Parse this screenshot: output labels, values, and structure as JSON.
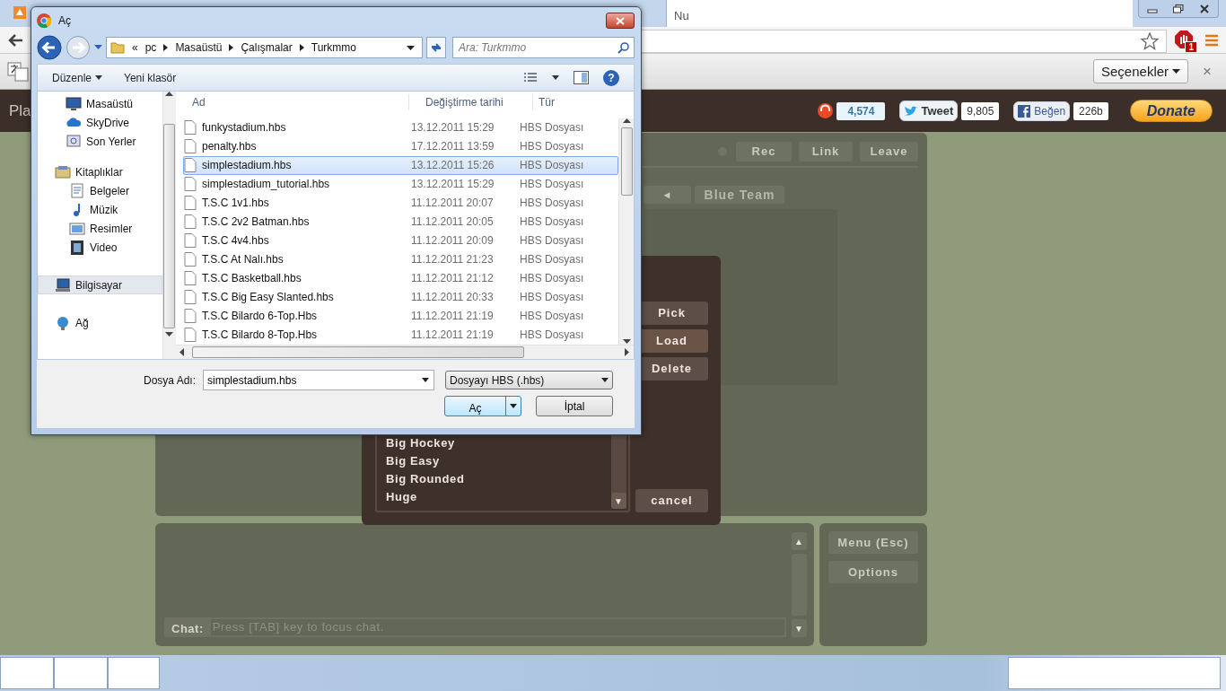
{
  "browser": {
    "tab_title": "Nu",
    "adblock_count": "1",
    "translate_options": "Seçenekler",
    "translate_close": "×"
  },
  "site_header": {
    "title": "Pla",
    "stumble_count": "4,574",
    "tweet": "Tweet",
    "tweet_count": "9,805",
    "like": "Beğen",
    "like_count": "226b",
    "donate": "Donate"
  },
  "room": {
    "top_buttons": [
      "Rec",
      "Link",
      "Leave"
    ],
    "team_arrow": "◄",
    "team_name": "Blue Team"
  },
  "chat": {
    "label": "Chat:",
    "placeholder": "Press [TAB] key to focus chat.",
    "scroll_up": "▲",
    "scroll_down": "▼"
  },
  "side_buttons": [
    "Menu (Esc)",
    "Options"
  ],
  "stadium_picker": {
    "stadiums": [
      {
        "name": "Big Hockey"
      },
      {
        "name": "Big Easy"
      },
      {
        "name": "Big Rounded"
      },
      {
        "name": "Huge"
      }
    ],
    "buttons": [
      "Pick",
      "Load",
      "Delete"
    ],
    "cancel": "cancel",
    "scroll_down": "▼"
  },
  "file_dialog": {
    "title": "Aç",
    "overflow": "«",
    "breadcrumb": [
      "pc",
      "Masaüstü",
      "Çalışmalar",
      "Turkmmo"
    ],
    "search_placeholder": "Ara: Turkmmo",
    "toolbar": {
      "organize": "Düzenle",
      "new_folder": "Yeni klasör",
      "help": "?"
    },
    "nav": [
      {
        "label": "Masaüstü",
        "kind": "desktop",
        "selected": false
      },
      {
        "label": "SkyDrive",
        "kind": "cloud",
        "selected": false
      },
      {
        "label": "Son Yerler",
        "kind": "recent",
        "selected": false
      },
      {
        "label": "Kitaplıklar",
        "kind": "library",
        "selected": false,
        "children": [
          {
            "label": "Belgeler",
            "kind": "documents",
            "selected": false
          },
          {
            "label": "Müzik",
            "kind": "music",
            "selected": false
          },
          {
            "label": "Resimler",
            "kind": "pictures",
            "selected": false
          },
          {
            "label": "Video",
            "kind": "video",
            "selected": false
          }
        ]
      },
      {
        "label": "Bilgisayar",
        "kind": "computer",
        "selected": true
      },
      {
        "label": "Ağ",
        "kind": "network",
        "selected": false
      }
    ],
    "columns": [
      "Ad",
      "Değiştirme tarihi",
      "Tür"
    ],
    "files": [
      {
        "name": "funkystadium.hbs",
        "modified": "13.12.2011 15:29",
        "type": "HBS Dosyası",
        "selected": false
      },
      {
        "name": "penalty.hbs",
        "modified": "17.12.2011 13:59",
        "type": "HBS Dosyası",
        "selected": false
      },
      {
        "name": "simplestadium.hbs",
        "modified": "13.12.2011 15:26",
        "type": "HBS Dosyası",
        "selected": true
      },
      {
        "name": "simplestadium_tutorial.hbs",
        "modified": "13.12.2011 15:29",
        "type": "HBS Dosyası",
        "selected": false
      },
      {
        "name": "T.S.C 1v1.hbs",
        "modified": "11.12.2011 20:07",
        "type": "HBS Dosyası",
        "selected": false
      },
      {
        "name": "T.S.C 2v2 Batman.hbs",
        "modified": "11.12.2011 20:05",
        "type": "HBS Dosyası",
        "selected": false
      },
      {
        "name": "T.S.C 4v4.hbs",
        "modified": "11.12.2011 20:09",
        "type": "HBS Dosyası",
        "selected": false
      },
      {
        "name": "T.S.C At Nalı.hbs",
        "modified": "11.12.2011 21:23",
        "type": "HBS Dosyası",
        "selected": false
      },
      {
        "name": "T.S.C Basketball.hbs",
        "modified": "11.12.2011 21:12",
        "type": "HBS Dosyası",
        "selected": false
      },
      {
        "name": "T.S.C Big Easy Slanted.hbs",
        "modified": "11.12.2011 20:33",
        "type": "HBS Dosyası",
        "selected": false
      },
      {
        "name": "T.S.C Bilardo 6-Top.Hbs",
        "modified": "11.12.2011 21:19",
        "type": "HBS Dosyası",
        "selected": false
      },
      {
        "name": "T.S.C Bilardo 8-Top.Hbs",
        "modified": "11.12.2011 21:19",
        "type": "HBS Dosyası",
        "selected": false
      }
    ],
    "file_name_label": "Dosya Adı:",
    "file_name": "simplestadium.hbs",
    "filter": "Dosyayı HBS (.hbs)",
    "open": "Aç",
    "cancel": "İptal"
  }
}
